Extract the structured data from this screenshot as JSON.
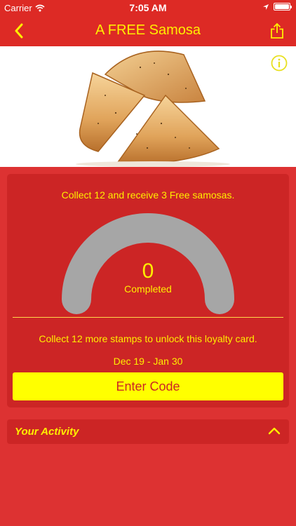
{
  "status_bar": {
    "carrier": "Carrier",
    "time": "7:05 AM"
  },
  "nav": {
    "title": "A FREE Samosa",
    "back_icon": "chevron-left-icon",
    "share_icon": "share-icon"
  },
  "hero": {
    "image_subject": "samosas",
    "info_icon": "info-icon"
  },
  "card": {
    "collect_text": "Collect 12 and receive 3 Free samosas.",
    "completed_count": "0",
    "completed_label": "Completed",
    "progress_fraction": 0,
    "unlock_text": "Collect 12 more stamps to unlock this loyalty card.",
    "date_range": "Dec 19 - Jan 30",
    "enter_code_label": "Enter Code"
  },
  "activity": {
    "label": "Your Activity",
    "chevron_icon": "chevron-up-icon"
  },
  "colors": {
    "background": "#dd3232",
    "card": "#cc2525",
    "accent_text": "#ffee00",
    "button": "#ffff00",
    "gauge_track": "#a6a6a6"
  }
}
